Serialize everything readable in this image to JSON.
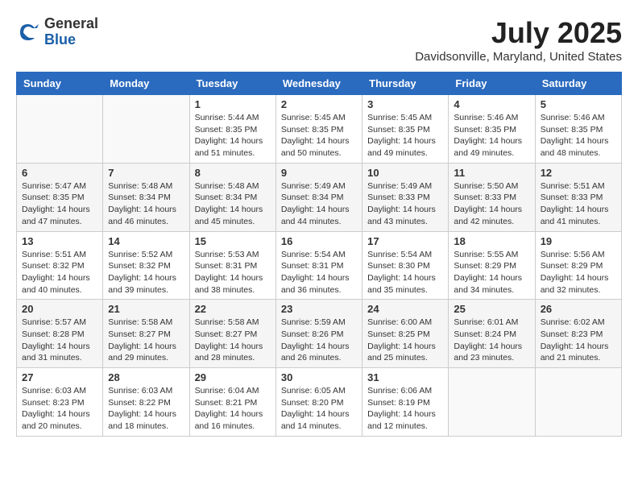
{
  "header": {
    "logo_general": "General",
    "logo_blue": "Blue",
    "month_title": "July 2025",
    "location": "Davidsonville, Maryland, United States"
  },
  "weekdays": [
    "Sunday",
    "Monday",
    "Tuesday",
    "Wednesday",
    "Thursday",
    "Friday",
    "Saturday"
  ],
  "weeks": [
    [
      {
        "day": "",
        "empty": true
      },
      {
        "day": "",
        "empty": true
      },
      {
        "day": "1",
        "sunrise": "5:44 AM",
        "sunset": "8:35 PM",
        "daylight": "14 hours and 51 minutes."
      },
      {
        "day": "2",
        "sunrise": "5:45 AM",
        "sunset": "8:35 PM",
        "daylight": "14 hours and 50 minutes."
      },
      {
        "day": "3",
        "sunrise": "5:45 AM",
        "sunset": "8:35 PM",
        "daylight": "14 hours and 49 minutes."
      },
      {
        "day": "4",
        "sunrise": "5:46 AM",
        "sunset": "8:35 PM",
        "daylight": "14 hours and 49 minutes."
      },
      {
        "day": "5",
        "sunrise": "5:46 AM",
        "sunset": "8:35 PM",
        "daylight": "14 hours and 48 minutes."
      }
    ],
    [
      {
        "day": "6",
        "sunrise": "5:47 AM",
        "sunset": "8:35 PM",
        "daylight": "14 hours and 47 minutes."
      },
      {
        "day": "7",
        "sunrise": "5:48 AM",
        "sunset": "8:34 PM",
        "daylight": "14 hours and 46 minutes."
      },
      {
        "day": "8",
        "sunrise": "5:48 AM",
        "sunset": "8:34 PM",
        "daylight": "14 hours and 45 minutes."
      },
      {
        "day": "9",
        "sunrise": "5:49 AM",
        "sunset": "8:34 PM",
        "daylight": "14 hours and 44 minutes."
      },
      {
        "day": "10",
        "sunrise": "5:49 AM",
        "sunset": "8:33 PM",
        "daylight": "14 hours and 43 minutes."
      },
      {
        "day": "11",
        "sunrise": "5:50 AM",
        "sunset": "8:33 PM",
        "daylight": "14 hours and 42 minutes."
      },
      {
        "day": "12",
        "sunrise": "5:51 AM",
        "sunset": "8:33 PM",
        "daylight": "14 hours and 41 minutes."
      }
    ],
    [
      {
        "day": "13",
        "sunrise": "5:51 AM",
        "sunset": "8:32 PM",
        "daylight": "14 hours and 40 minutes."
      },
      {
        "day": "14",
        "sunrise": "5:52 AM",
        "sunset": "8:32 PM",
        "daylight": "14 hours and 39 minutes."
      },
      {
        "day": "15",
        "sunrise": "5:53 AM",
        "sunset": "8:31 PM",
        "daylight": "14 hours and 38 minutes."
      },
      {
        "day": "16",
        "sunrise": "5:54 AM",
        "sunset": "8:31 PM",
        "daylight": "14 hours and 36 minutes."
      },
      {
        "day": "17",
        "sunrise": "5:54 AM",
        "sunset": "8:30 PM",
        "daylight": "14 hours and 35 minutes."
      },
      {
        "day": "18",
        "sunrise": "5:55 AM",
        "sunset": "8:29 PM",
        "daylight": "14 hours and 34 minutes."
      },
      {
        "day": "19",
        "sunrise": "5:56 AM",
        "sunset": "8:29 PM",
        "daylight": "14 hours and 32 minutes."
      }
    ],
    [
      {
        "day": "20",
        "sunrise": "5:57 AM",
        "sunset": "8:28 PM",
        "daylight": "14 hours and 31 minutes."
      },
      {
        "day": "21",
        "sunrise": "5:58 AM",
        "sunset": "8:27 PM",
        "daylight": "14 hours and 29 minutes."
      },
      {
        "day": "22",
        "sunrise": "5:58 AM",
        "sunset": "8:27 PM",
        "daylight": "14 hours and 28 minutes."
      },
      {
        "day": "23",
        "sunrise": "5:59 AM",
        "sunset": "8:26 PM",
        "daylight": "14 hours and 26 minutes."
      },
      {
        "day": "24",
        "sunrise": "6:00 AM",
        "sunset": "8:25 PM",
        "daylight": "14 hours and 25 minutes."
      },
      {
        "day": "25",
        "sunrise": "6:01 AM",
        "sunset": "8:24 PM",
        "daylight": "14 hours and 23 minutes."
      },
      {
        "day": "26",
        "sunrise": "6:02 AM",
        "sunset": "8:23 PM",
        "daylight": "14 hours and 21 minutes."
      }
    ],
    [
      {
        "day": "27",
        "sunrise": "6:03 AM",
        "sunset": "8:23 PM",
        "daylight": "14 hours and 20 minutes."
      },
      {
        "day": "28",
        "sunrise": "6:03 AM",
        "sunset": "8:22 PM",
        "daylight": "14 hours and 18 minutes."
      },
      {
        "day": "29",
        "sunrise": "6:04 AM",
        "sunset": "8:21 PM",
        "daylight": "14 hours and 16 minutes."
      },
      {
        "day": "30",
        "sunrise": "6:05 AM",
        "sunset": "8:20 PM",
        "daylight": "14 hours and 14 minutes."
      },
      {
        "day": "31",
        "sunrise": "6:06 AM",
        "sunset": "8:19 PM",
        "daylight": "14 hours and 12 minutes."
      },
      {
        "day": "",
        "empty": true
      },
      {
        "day": "",
        "empty": true
      }
    ]
  ],
  "labels": {
    "sunrise": "Sunrise:",
    "sunset": "Sunset:",
    "daylight": "Daylight:"
  }
}
